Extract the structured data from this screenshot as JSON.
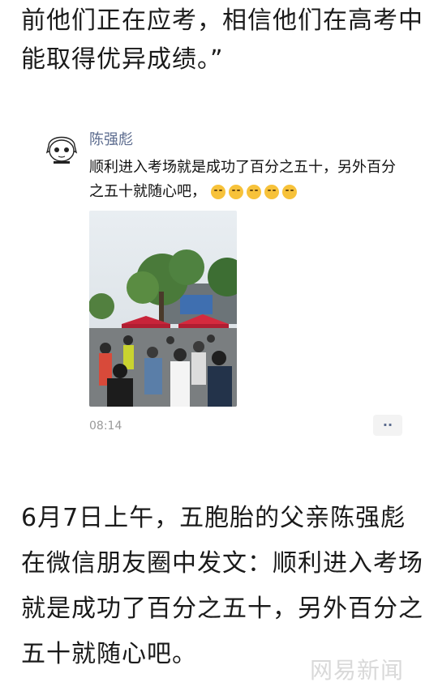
{
  "article": {
    "intro_text": "前他们正在应考，相信他们在高考中能取得优异成绩。”",
    "body_text": "6月7日上午，五胞胎的父亲陈强彪在微信朋友圈中发文：顺利进入考场就是成功了百分之五十，另外百分之五十就随心吧。"
  },
  "post": {
    "author": "陈强彪",
    "text": "顺利进入考场就是成功了百分之五十，另外百分之五十就随心吧，",
    "emoji_icons": [
      "laugh-cry-icon",
      "laugh-cry-icon",
      "laugh-cry-icon",
      "laugh-cry-icon",
      "laugh-cry-icon"
    ],
    "time": "08:14",
    "more_label": "··"
  },
  "watermark": "网易新闻",
  "colors": {
    "author": "#5b6b8e",
    "time": "#999999",
    "emoji": "#f7c23a"
  }
}
